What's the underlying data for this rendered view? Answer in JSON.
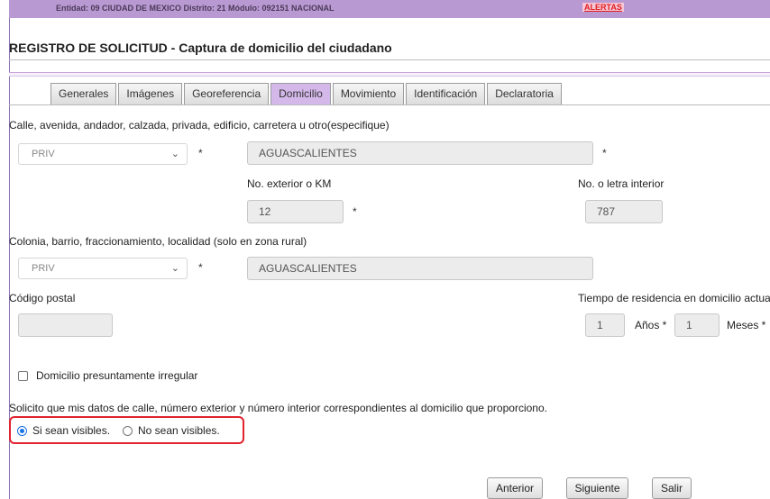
{
  "topbar": {
    "entity_text": "Entidad: 09 CIUDAD DE MEXICO Distrito: 21 Módulo: 092151 NACIONAL",
    "alerts_label": "ALERTAS"
  },
  "page": {
    "title": "REGISTRO DE SOLICITUD - Captura de domicilio del ciudadano"
  },
  "tabs": [
    {
      "label": "Generales",
      "active": false
    },
    {
      "label": "Imágenes",
      "active": false
    },
    {
      "label": "Georeferencia",
      "active": false
    },
    {
      "label": "Domicilio",
      "active": true
    },
    {
      "label": "Movimiento",
      "active": false
    },
    {
      "label": "Identificación",
      "active": false
    },
    {
      "label": "Declaratoria",
      "active": false
    }
  ],
  "form": {
    "street_section_label": "Calle, avenida, andador, calzada, privada, edificio, carretera u otro(especifique)",
    "street_type_value": "PRIV",
    "street_name_value": "AGUASCALIENTES",
    "required_mark": "*",
    "ext_number_label": "No. exterior o KM",
    "ext_number_value": "12",
    "int_number_label": "No. o letra interior",
    "int_number_value": "787",
    "colonia_section_label": "Colonia, barrio, fraccionamiento, localidad (solo en zona rural)",
    "colonia_type_value": "PRIV",
    "colonia_name_value": "AGUASCALIENTES",
    "postal_code_label": "Código postal",
    "postal_code_value": "",
    "residence_time_label": "Tiempo de residencia en domicilio actua",
    "years_value": "1",
    "years_label": "Años *",
    "months_value": "1",
    "months_label": "Meses *",
    "irregular_label": "Domicilio presuntamente irregular",
    "irregular_checked": false,
    "visibility_question": "Solicito que mis datos de calle, número exterior y número interior correspondientes al domicilio que proporciono.",
    "visible_option": "Si sean visibles.",
    "not_visible_option": "No sean visibles.",
    "selected_option": "Si sean visibles."
  },
  "buttons": {
    "previous": "Anterior",
    "next": "Siguiente",
    "exit": "Salir"
  },
  "colors": {
    "topbar": "#b999d1",
    "active_tab": "#d4b8ea",
    "highlight_box": "#e2222e",
    "alert_text": "#e01e1e"
  }
}
